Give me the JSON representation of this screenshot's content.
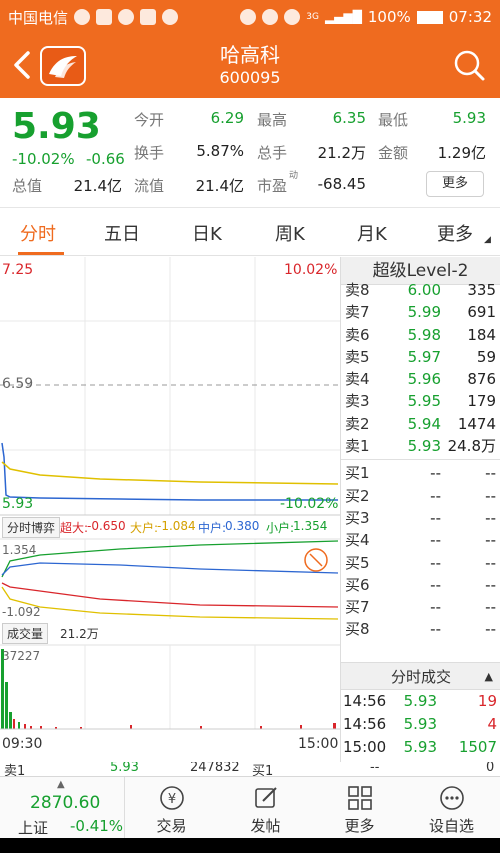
{
  "status_bar": {
    "carrier": "中国电信",
    "network": "3G",
    "battery": "100%",
    "time": "07:32"
  },
  "header": {
    "stock_name": "哈高科",
    "stock_code": "600095"
  },
  "quote": {
    "price": "5.93",
    "change_pct": "-10.02%",
    "change_abs": "-0.66",
    "fields": [
      {
        "label": "今开",
        "value": "6.29",
        "color": "#17a02f"
      },
      {
        "label": "最高",
        "value": "6.35",
        "color": "#17a02f"
      },
      {
        "label": "最低",
        "value": "5.93",
        "color": "#17a02f"
      },
      {
        "label": "换手",
        "value": "5.87%",
        "color": "#222222"
      },
      {
        "label": "总手",
        "value": "21.2万",
        "color": "#222222"
      },
      {
        "label": "金额",
        "value": "1.29亿",
        "color": "#222222"
      },
      {
        "label": "总值",
        "value": "21.4亿",
        "color": "#222222"
      },
      {
        "label": "流值",
        "value": "21.4亿",
        "color": "#222222"
      },
      {
        "label": "市盈",
        "value": "-68.45",
        "color": "#222222"
      }
    ],
    "pe_superscript": "动",
    "more_label": "更多"
  },
  "tabs": [
    "分时",
    "五日",
    "日K",
    "周K",
    "月K",
    "更多"
  ],
  "active_tab": 0,
  "chart": {
    "price_high": "7.25",
    "pct_high": "10.02%",
    "prev_close": "6.59",
    "price_low": "5.93",
    "pct_low": "-10.02%",
    "game_title": "分时博弈",
    "game_items": [
      {
        "label": "超大:",
        "value": "-0.650",
        "color": "#d9262b"
      },
      {
        "label": "大户:",
        "value": "-1.084",
        "color": "#d4a000"
      },
      {
        "label": "中户:",
        "value": "0.380",
        "color": "#2c66d1"
      },
      {
        "label": "小户:",
        "value": "1.354",
        "color": "#17a02f"
      }
    ],
    "game_max": "1.354",
    "game_min": "-1.092",
    "volume_label": "成交量",
    "volume_total": "21.2万",
    "volume_max": "37227",
    "time_start": "09:30",
    "time_end": "15:00"
  },
  "level2": {
    "title": "超级Level-2",
    "asks": [
      {
        "label": "卖8",
        "price": "6.00",
        "vol": "335"
      },
      {
        "label": "卖7",
        "price": "5.99",
        "vol": "691"
      },
      {
        "label": "卖6",
        "price": "5.98",
        "vol": "184"
      },
      {
        "label": "卖5",
        "price": "5.97",
        "vol": "59"
      },
      {
        "label": "卖4",
        "price": "5.96",
        "vol": "876"
      },
      {
        "label": "卖3",
        "price": "5.95",
        "vol": "179"
      },
      {
        "label": "卖2",
        "price": "5.94",
        "vol": "1474"
      },
      {
        "label": "卖1",
        "price": "5.93",
        "vol": "24.8万"
      }
    ],
    "bids": [
      {
        "label": "买1",
        "price": "--",
        "vol": "--"
      },
      {
        "label": "买2",
        "price": "--",
        "vol": "--"
      },
      {
        "label": "买3",
        "price": "--",
        "vol": "--"
      },
      {
        "label": "买4",
        "price": "--",
        "vol": "--"
      },
      {
        "label": "买5",
        "price": "--",
        "vol": "--"
      },
      {
        "label": "买6",
        "price": "--",
        "vol": "--"
      },
      {
        "label": "买7",
        "price": "--",
        "vol": "--"
      },
      {
        "label": "买8",
        "price": "--",
        "vol": "--"
      }
    ],
    "ticks_title": "分时成交",
    "ticks": [
      {
        "time": "14:56",
        "price": "5.93",
        "vol": "19"
      },
      {
        "time": "14:56",
        "price": "5.93",
        "vol": "4"
      },
      {
        "time": "15:00",
        "price": "5.93",
        "vol": "1507"
      }
    ]
  },
  "bottom_strip": {
    "ask_label": "卖1",
    "ask_price": "5.93",
    "ask_vol": "247832",
    "bid_label": "买1",
    "bid_price": "--",
    "bid_vol": "0"
  },
  "bottom_nav": {
    "index_value": "2870.60",
    "index_name": "上证",
    "index_change": "-0.41%",
    "items": [
      "交易",
      "发帖",
      "更多",
      "设自选"
    ]
  },
  "colors": {
    "brand": "#ef6b1f",
    "down": "#17a02f",
    "up": "#d9262b"
  }
}
